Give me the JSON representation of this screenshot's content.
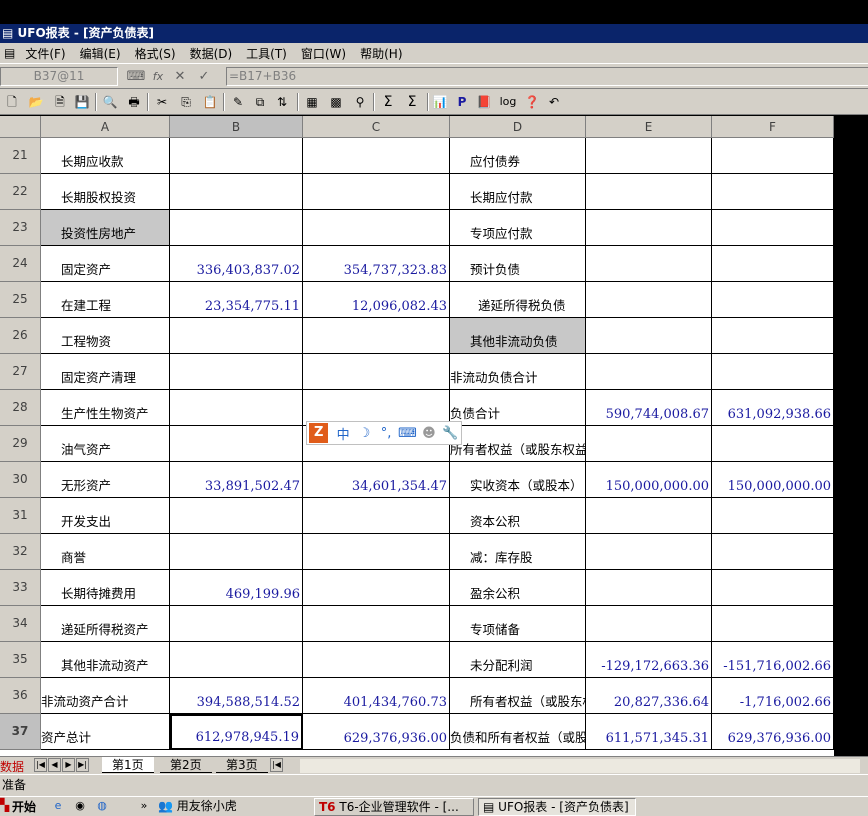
{
  "window": {
    "title": "UFO报表 - [资产负债表]"
  },
  "menu": [
    "文件(F)",
    "编辑(E)",
    "格式(S)",
    "数据(D)",
    "工具(T)",
    "窗口(W)",
    "帮助(H)"
  ],
  "formula_bar": {
    "cell_ref": "B37@11",
    "formula": "=B17+B36",
    "fx_label": "fx",
    "cancel_label": "✕",
    "ok_label": "✓"
  },
  "toolbar": {
    "icons": [
      "new-file-icon",
      "open-folder-icon",
      "document-icon",
      "save-icon",
      "print-preview-icon",
      "print-icon",
      "cut-icon",
      "copy-icon",
      "paste-icon",
      "format-icon",
      "insert-icon",
      "sort-icon",
      "table-icon",
      "grid-icon",
      "find-icon",
      "sum-icon",
      "sum-select-icon",
      "chart-icon",
      "bold-p-icon",
      "book-icon",
      "log-icon",
      "help-icon",
      "undo-icon"
    ],
    "glyphs": {
      "p": "P",
      "log": "log"
    }
  },
  "columns": [
    "A",
    "B",
    "C",
    "D",
    "E",
    "F"
  ],
  "rows": [
    {
      "n": "21",
      "a": "长期应收款",
      "b": "",
      "c": "",
      "d": "应付债券",
      "e": "",
      "f": ""
    },
    {
      "n": "22",
      "a": "长期股权投资",
      "b": "",
      "c": "",
      "d": "长期应付款",
      "e": "",
      "f": ""
    },
    {
      "n": "23",
      "a": "投资性房地产",
      "b": "",
      "c": "",
      "d": "专项应付款",
      "e": "",
      "f": ""
    },
    {
      "n": "24",
      "a": "固定资产",
      "b": "336,403,837.02",
      "c": "354,737,323.83",
      "d": "预计负债",
      "e": "",
      "f": ""
    },
    {
      "n": "25",
      "a": "在建工程",
      "b": "23,354,775.11",
      "c": "12,096,082.43",
      "d": "递延所得税负债",
      "e": "",
      "f": ""
    },
    {
      "n": "26",
      "a": "工程物资",
      "b": "",
      "c": "",
      "d": "其他非流动负债",
      "e": "",
      "f": ""
    },
    {
      "n": "27",
      "a": "固定资产清理",
      "b": "",
      "c": "",
      "d": "非流动负债合计",
      "e": "",
      "f": ""
    },
    {
      "n": "28",
      "a": "生产性生物资产",
      "b": "",
      "c": "",
      "d": "负债合计",
      "e": "590,744,008.67",
      "f": "631,092,938.66"
    },
    {
      "n": "29",
      "a": "油气资产",
      "b": "",
      "c": "",
      "d": "所有者权益（或股东权益",
      "e": "",
      "f": ""
    },
    {
      "n": "30",
      "a": "无形资产",
      "b": "33,891,502.47",
      "c": "34,601,354.47",
      "d": "实收资本（或股本）",
      "e": "150,000,000.00",
      "f": "150,000,000.00"
    },
    {
      "n": "31",
      "a": "开发支出",
      "b": "",
      "c": "",
      "d": "资本公积",
      "e": "",
      "f": ""
    },
    {
      "n": "32",
      "a": "商誉",
      "b": "",
      "c": "",
      "d": "减：库存股",
      "e": "",
      "f": ""
    },
    {
      "n": "33",
      "a": "长期待摊费用",
      "b": "469,199.96",
      "c": "",
      "d": "盈余公积",
      "e": "",
      "f": ""
    },
    {
      "n": "34",
      "a": "递延所得税资产",
      "b": "",
      "c": "",
      "d": "专项储备",
      "e": "",
      "f": ""
    },
    {
      "n": "35",
      "a": "其他非流动资产",
      "b": "",
      "c": "",
      "d": "未分配利润",
      "e": "-129,172,663.36",
      "f": "-151,716,002.66"
    },
    {
      "n": "36",
      "a": "非流动资产合计",
      "b": "394,588,514.52",
      "c": "401,434,760.73",
      "d": "所有者权益（或股东权",
      "e": "20,827,336.64",
      "f": "-1,716,002.66"
    },
    {
      "n": "37",
      "a": "资产总计",
      "b": "612,978,945.19",
      "c": "629,376,936.00",
      "d": "负债和所有者权益（或股",
      "e": "611,571,345.31",
      "f": "629,376,936.00"
    }
  ],
  "ime": {
    "logo": "Z",
    "lang": "中"
  },
  "tabs": {
    "mode": "数据",
    "sheets": [
      "第1页",
      "第2页",
      "第3页"
    ]
  },
  "status": {
    "text": "准备"
  },
  "taskbar": {
    "start": "开始",
    "tasks": [
      "用友徐小虎",
      "T6-企业管理软件 - [...",
      "UFO报表 - [资产负债表]"
    ],
    "more": "»"
  }
}
